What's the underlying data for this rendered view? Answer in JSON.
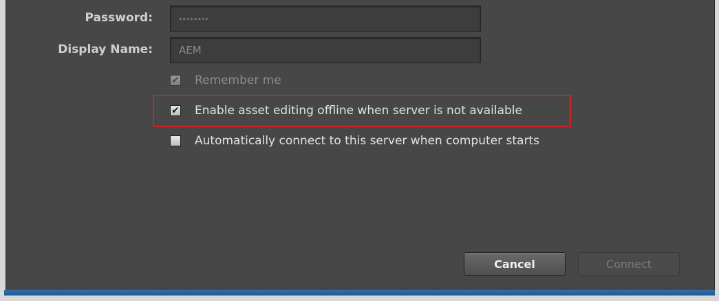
{
  "form": {
    "password_label": "Password:",
    "password_value": "********",
    "display_name_label": "Display Name:",
    "display_name_value": "AEM"
  },
  "options": {
    "remember_me": {
      "label": "Remember me",
      "checked": true,
      "enabled": false
    },
    "offline_editing": {
      "label": "Enable asset editing offline when server is not available",
      "checked": true,
      "enabled": true
    },
    "auto_connect": {
      "label": "Automatically connect to this server when computer starts",
      "checked": false,
      "enabled": true
    }
  },
  "buttons": {
    "cancel_label": "Cancel",
    "connect_label": "Connect"
  },
  "colors": {
    "highlight": "#d0202a",
    "accent": "#2f6fa8"
  }
}
